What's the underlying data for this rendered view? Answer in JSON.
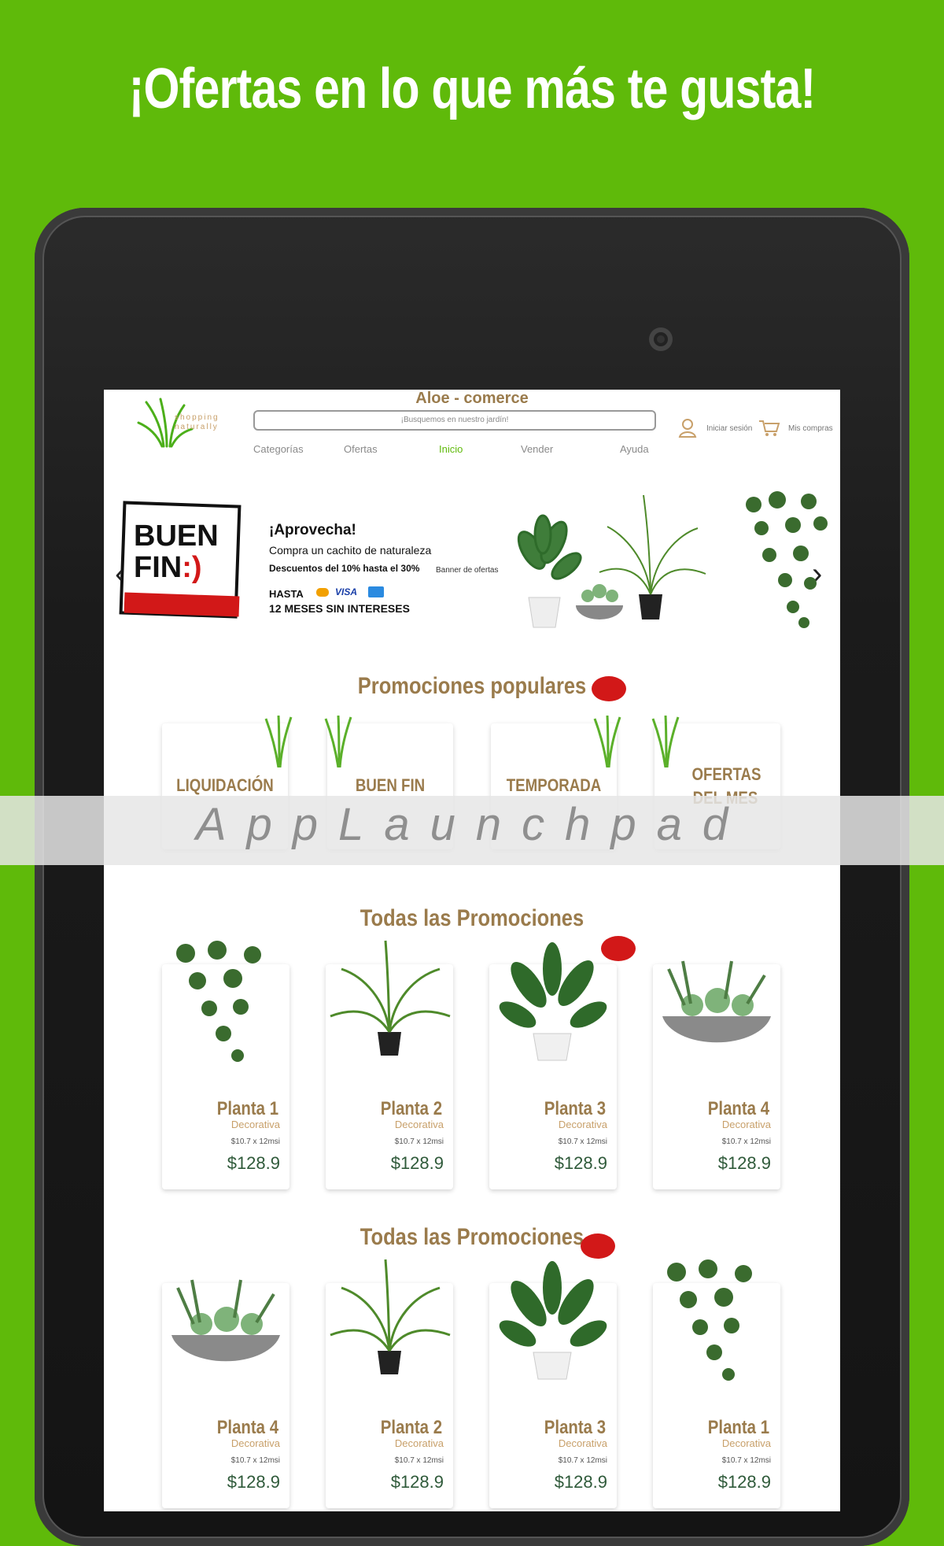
{
  "headline": "¡Ofertas en lo que más te gusta!",
  "watermark": "AppLaunchpad",
  "site": {
    "brand": "Aloe - comerce",
    "logo_text_1": "shopping",
    "logo_text_2": "naturally",
    "search_placeholder": "¡Busquemos en nuestro jardín!",
    "nav": [
      "Categorías",
      "Ofertas",
      "Inicio",
      "Vender",
      "Ayuda"
    ],
    "login": "Iniciar sesión",
    "cart": "Mis compras"
  },
  "banner": {
    "cal_line1": "BUEN",
    "cal_line2": "FIN",
    "cal_face": ":)",
    "title": "¡Aprovecha!",
    "subtitle": "Compra un cachito de naturaleza",
    "discount": "Descuentos del 10% hasta el 30%",
    "banner_label": "Banner de ofertas",
    "hasta": "HASTA",
    "msi": "12 MESES SIN INTERESES",
    "card_visa": "VISA"
  },
  "promos_title": "Promociones populares",
  "promos": [
    {
      "label": "LIQUIDACIÓN"
    },
    {
      "label": "BUEN FIN"
    },
    {
      "label": "TEMPORADA"
    },
    {
      "label_line1": "OFERTAS",
      "label_line2": "DEL MES"
    }
  ],
  "section1_title": "Todas las Promociones",
  "section2_title": "Todas las Promociones",
  "products_row1": [
    {
      "name": "Planta 1",
      "type": "Decorativa",
      "spec": "$10.7 x 12msi",
      "price": "$128.9",
      "plant": "hanging-plant"
    },
    {
      "name": "Planta 2",
      "type": "Decorativa",
      "spec": "$10.7 x 12msi",
      "price": "$128.9",
      "plant": "palm-plant"
    },
    {
      "name": "Planta 3",
      "type": "Decorativa",
      "spec": "$10.7 x 12msi",
      "price": "$128.9",
      "plant": "bird-of-paradise-plant"
    },
    {
      "name": "Planta 4",
      "type": "Decorativa",
      "spec": "$10.7 x 12msi",
      "price": "$128.9",
      "plant": "succulent-bowl"
    }
  ],
  "products_row2": [
    {
      "name": "Planta 4",
      "type": "Decorativa",
      "spec": "$10.7 x 12msi",
      "price": "$128.9",
      "plant": "succulent-bowl"
    },
    {
      "name": "Planta 2",
      "type": "Decorativa",
      "spec": "$10.7 x 12msi",
      "price": "$128.9",
      "plant": "palm-plant"
    },
    {
      "name": "Planta 3",
      "type": "Decorativa",
      "spec": "$10.7 x 12msi",
      "price": "$128.9",
      "plant": "bird-of-paradise-plant"
    },
    {
      "name": "Planta 1",
      "type": "Decorativa",
      "spec": "$10.7 x 12msi",
      "price": "$128.9",
      "plant": "hanging-plant"
    }
  ],
  "colors": {
    "background": "#5fba0a",
    "accent_gold": "#9a7b4c",
    "price_green": "#2f5a3a",
    "badge_red": "#d21818"
  }
}
